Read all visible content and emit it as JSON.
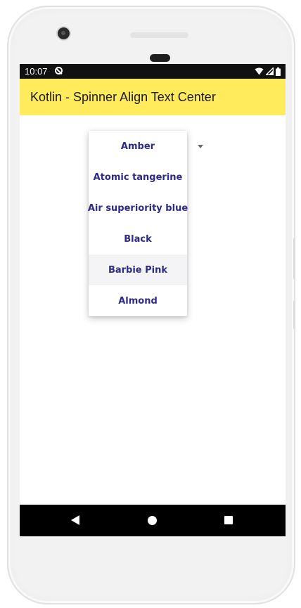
{
  "status_bar": {
    "time": "10:07"
  },
  "app_bar": {
    "title": "Kotlin - Spinner Align Text Center",
    "color": "#ffeb5c"
  },
  "spinner": {
    "selected_value": "Amber",
    "text_color": "#2e2a8a",
    "options": [
      {
        "label": "Amber",
        "highlighted": false
      },
      {
        "label": "Atomic tangerine",
        "highlighted": false
      },
      {
        "label": "Air superiority blue",
        "highlighted": false
      },
      {
        "label": "Black",
        "highlighted": false
      },
      {
        "label": "Barbie Pink",
        "highlighted": true
      },
      {
        "label": "Almond",
        "highlighted": false
      }
    ]
  },
  "icons": {
    "status": [
      "wifi-icon",
      "signal-icon",
      "battery-icon"
    ],
    "navigation": [
      "back-icon",
      "home-icon",
      "recents-icon"
    ]
  }
}
